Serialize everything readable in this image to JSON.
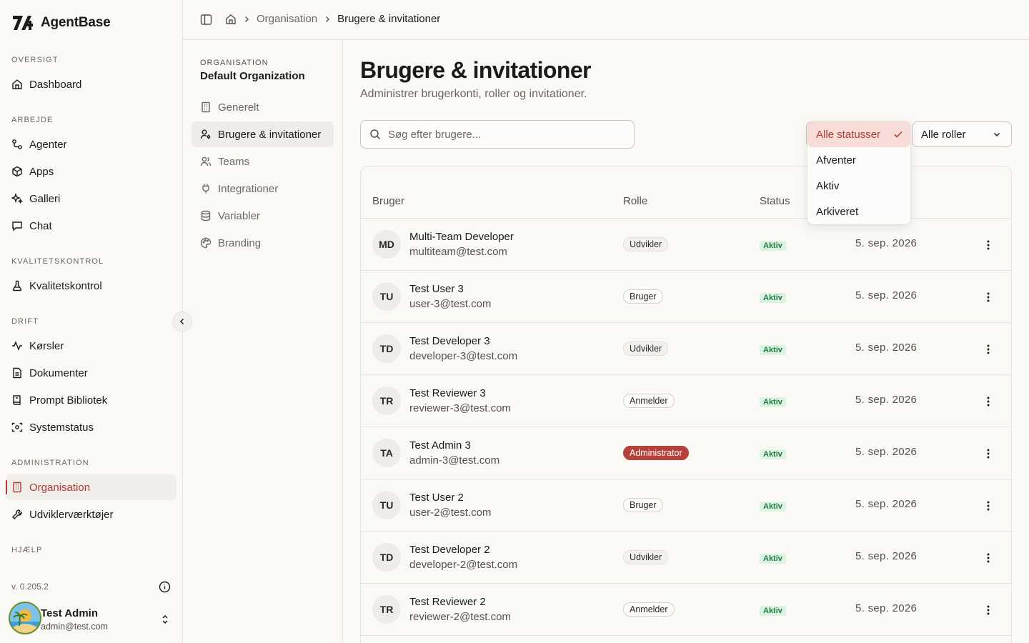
{
  "brand": {
    "name": "AgentBase"
  },
  "sidebar": {
    "sections": {
      "oversigt": "OVERSIGT",
      "arbejde": "ARBEJDE",
      "kvalitet": "KVALITETSKONTROL",
      "drift": "DRIFT",
      "administration": "ADMINISTRATION",
      "hjaelp": "HJÆLP"
    },
    "items": {
      "dashboard": "Dashboard",
      "agenter": "Agenter",
      "apps": "Apps",
      "galleri": "Galleri",
      "chat": "Chat",
      "kvalitetskontrol": "Kvalitetskontrol",
      "korsler": "Kørsler",
      "dokumenter": "Dokumenter",
      "prompt": "Prompt Bibliotek",
      "systemstatus": "Systemstatus",
      "organisation": "Organisation",
      "udvikler": "Udviklerværktøjer"
    },
    "version": "v. 0.205.2",
    "user": {
      "name": "Test Admin",
      "email": "admin@test.com"
    }
  },
  "breadcrumb": {
    "parent": "Organisation",
    "current": "Brugere & invitationer"
  },
  "subnav": {
    "label": "ORGANISATION",
    "org": "Default Organization",
    "items": {
      "generelt": "Generelt",
      "brugere": "Brugere & invitationer",
      "teams": "Teams",
      "integrationer": "Integrationer",
      "variabler": "Variabler",
      "branding": "Branding"
    }
  },
  "page": {
    "title": "Brugere & invitationer",
    "subtitle": "Administrer brugerkonti, roller og invitationer."
  },
  "search": {
    "placeholder": "Søg efter brugere..."
  },
  "filters": {
    "roles": "Alle roller",
    "status_options": [
      "Alle statusser",
      "Afventer",
      "Aktiv",
      "Arkiveret"
    ],
    "status_selected": "Alle statusser"
  },
  "table": {
    "headers": {
      "user": "Bruger",
      "role": "Rolle",
      "status": "Status"
    },
    "rows": [
      {
        "initials": "MD",
        "name": "Multi-Team Developer",
        "email": "multiteam@test.com",
        "role": "Udvikler",
        "status": "Aktiv",
        "date": "5. sep. 2026"
      },
      {
        "initials": "TU",
        "name": "Test User 3",
        "email": "user-3@test.com",
        "role": "Bruger",
        "status": "Aktiv",
        "date": "5. sep. 2026"
      },
      {
        "initials": "TD",
        "name": "Test Developer 3",
        "email": "developer-3@test.com",
        "role": "Udvikler",
        "status": "Aktiv",
        "date": "5. sep. 2026"
      },
      {
        "initials": "TR",
        "name": "Test Reviewer 3",
        "email": "reviewer-3@test.com",
        "role": "Anmelder",
        "status": "Aktiv",
        "date": "5. sep. 2026"
      },
      {
        "initials": "TA",
        "name": "Test Admin 3",
        "email": "admin-3@test.com",
        "role": "Administrator",
        "status": "Aktiv",
        "date": "5. sep. 2026"
      },
      {
        "initials": "TU",
        "name": "Test User 2",
        "email": "user-2@test.com",
        "role": "Bruger",
        "status": "Aktiv",
        "date": "5. sep. 2026"
      },
      {
        "initials": "TD",
        "name": "Test Developer 2",
        "email": "developer-2@test.com",
        "role": "Udvikler",
        "status": "Aktiv",
        "date": "5. sep. 2026"
      },
      {
        "initials": "TR",
        "name": "Test Reviewer 2",
        "email": "reviewer-2@test.com",
        "role": "Anmelder",
        "status": "Aktiv",
        "date": "5. sep. 2026"
      }
    ]
  },
  "colors": {
    "accent": "#b23a33",
    "admin_badge": "#b5413a",
    "active_green": "#1f7a3e"
  }
}
